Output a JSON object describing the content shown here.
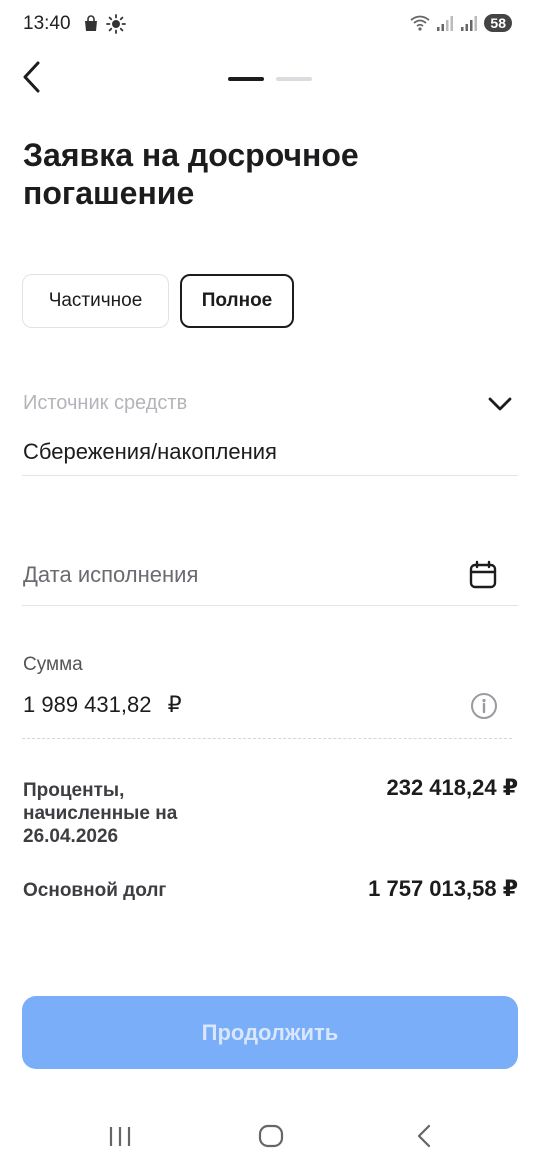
{
  "status_bar": {
    "time": "13:40",
    "battery": "58",
    "icons_left": [
      "shopping-bag-icon",
      "sun-icon"
    ],
    "icons_right": [
      "wifi-icon",
      "signal-icon",
      "signal-icon"
    ]
  },
  "header": {
    "step_total": 2,
    "step_current": 1,
    "title": "Заявка на досрочное погашение"
  },
  "repayment_type": {
    "options": [
      "Частичное",
      "Полное"
    ],
    "selected": "Полное"
  },
  "source_field": {
    "label": "Источник средств",
    "value": "Сбережения/накопления"
  },
  "date_field": {
    "placeholder": "Дата исполнения"
  },
  "amount": {
    "label": "Сумма",
    "value": "1 989 431,82",
    "currency": "₽"
  },
  "details": {
    "interest_label": "Проценты, начисленные на 26.04.2026",
    "interest_value": "232 418,24 ₽",
    "principal_label": "Основной долг",
    "principal_value": "1 757 013,58 ₽"
  },
  "actions": {
    "continue_label": "Продолжить"
  },
  "colors": {
    "primary_disabled": "#7aaef9",
    "text_primary": "#1c1c1e",
    "text_placeholder": "#b4b4ba"
  }
}
